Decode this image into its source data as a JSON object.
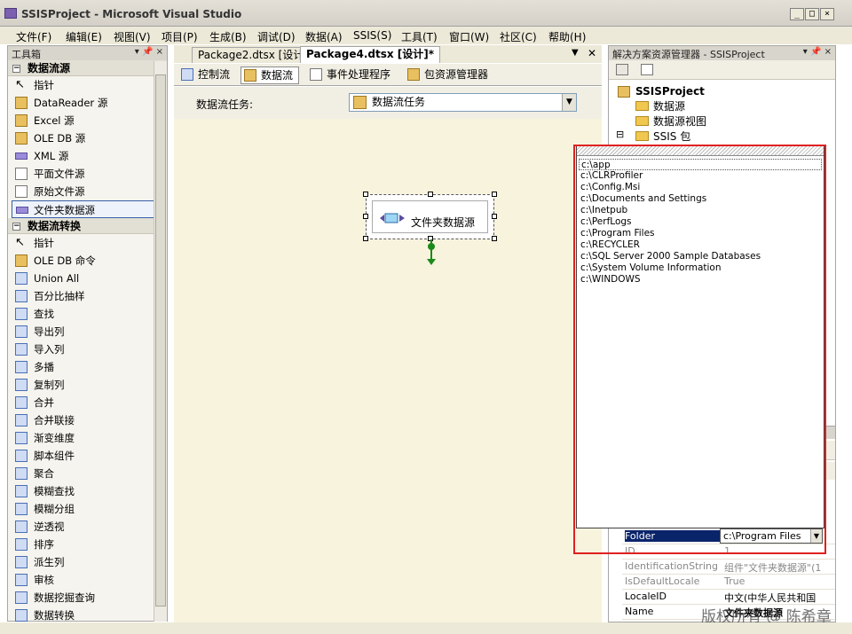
{
  "window": {
    "title": "SSISProject - Microsoft Visual Studio",
    "min_glyph": "_",
    "max_glyph": "□",
    "close_glyph": "×"
  },
  "menu": [
    "文件(F)",
    "编辑(E)",
    "视图(V)",
    "项目(P)",
    "生成(B)",
    "调试(D)",
    "数据(A)",
    "SSIS(S)",
    "工具(T)",
    "窗口(W)",
    "社区(C)",
    "帮助(H)"
  ],
  "toolbox": {
    "title": "工具箱",
    "pin": "▾ 📌 ×",
    "category1": "数据流源",
    "category2": "数据流转换",
    "sources": [
      "指针",
      "DataReader 源",
      "Excel 源",
      "OLE DB 源",
      "XML 源",
      "平面文件源",
      "原始文件源",
      "文件夹数据源"
    ],
    "transforms": [
      "指针",
      "OLE DB 命令",
      "Union All",
      "百分比抽样",
      "查找",
      "导出列",
      "导入列",
      "多播",
      "复制列",
      "合并",
      "合并联接",
      "渐变维度",
      "脚本组件",
      "聚合",
      "模糊查找",
      "模糊分组",
      "逆透视",
      "排序",
      "派生列",
      "审核",
      "数据挖掘查询",
      "数据转换"
    ]
  },
  "doc_tabs": [
    "Package2.dtsx [设计]",
    "Package4.dtsx [设计]*"
  ],
  "design_tabs": [
    "控制流",
    "数据流",
    "事件处理程序",
    "包资源管理器"
  ],
  "task_row": {
    "label": "数据流任务:",
    "value": "数据流任务"
  },
  "component": {
    "label": "文件夹数据源"
  },
  "solution_explorer": {
    "title": "解决方案资源管理器 - SSISProject",
    "project": "SSISProject",
    "children": [
      "数据源",
      "数据源视图",
      "SSIS 包"
    ]
  },
  "folder_dropdown": {
    "items": [
      "c:\\app",
      "c:\\CLRProfiler",
      "c:\\Config.Msi",
      "c:\\Documents and Settings",
      "c:\\Inetpub",
      "c:\\PerfLogs",
      "c:\\Program Files",
      "c:\\RECYCLER",
      "c:\\SQL Server 2000 Sample Databases",
      "c:\\System Volume Information",
      "c:\\WINDOWS"
    ]
  },
  "properties": {
    "rows": [
      {
        "key": "Folder",
        "value": "c:\\Program Files"
      },
      {
        "key": "ID",
        "value": "1"
      },
      {
        "key": "IdentificationString",
        "value": "组件\"文件夹数据源\"(1"
      },
      {
        "key": "IsDefaultLocale",
        "value": "True"
      },
      {
        "key": "LocaleID",
        "value": "中文(中华人民共和国"
      },
      {
        "key": "Name",
        "value": "文件夹数据源"
      }
    ]
  },
  "watermark": "版权所有 @ 陈希章",
  "colors": {
    "highlight": "#e02020",
    "selection": "#0a246a",
    "canvas": "#f7f3dd",
    "connector": "#1a8a1a"
  }
}
